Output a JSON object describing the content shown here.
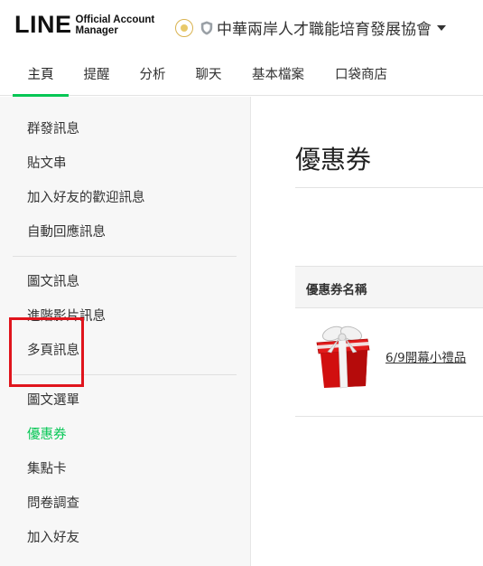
{
  "brand": {
    "logo_main": "LINE",
    "logo_sub_1": "Official Account",
    "logo_sub_2": "Manager"
  },
  "account": {
    "name": "中華兩岸人才職能培育發展協會"
  },
  "tabs": [
    {
      "label": "主頁",
      "active": true
    },
    {
      "label": "提醒",
      "has_dot": true
    },
    {
      "label": "分析"
    },
    {
      "label": "聊天"
    },
    {
      "label": "基本檔案"
    },
    {
      "label": "口袋商店"
    }
  ],
  "sidebar": {
    "groups": [
      [
        "群發訊息",
        "貼文串",
        "加入好友的歡迎訊息",
        "自動回應訊息"
      ],
      [
        "圖文訊息",
        "進階影片訊息",
        "多頁訊息"
      ],
      [
        "圖文選單",
        "優惠券",
        "集點卡",
        "問卷調查",
        "加入好友"
      ]
    ],
    "active_item": "優惠券"
  },
  "main": {
    "title": "優惠券",
    "table": {
      "header": "優惠券名稱",
      "rows": [
        {
          "name": "6/9開幕小禮品",
          "image": "gift-box"
        }
      ]
    }
  },
  "colors": {
    "accent": "#06c755",
    "highlight_box": "#e0141c",
    "sidebar_bg": "#f7f7f7"
  }
}
